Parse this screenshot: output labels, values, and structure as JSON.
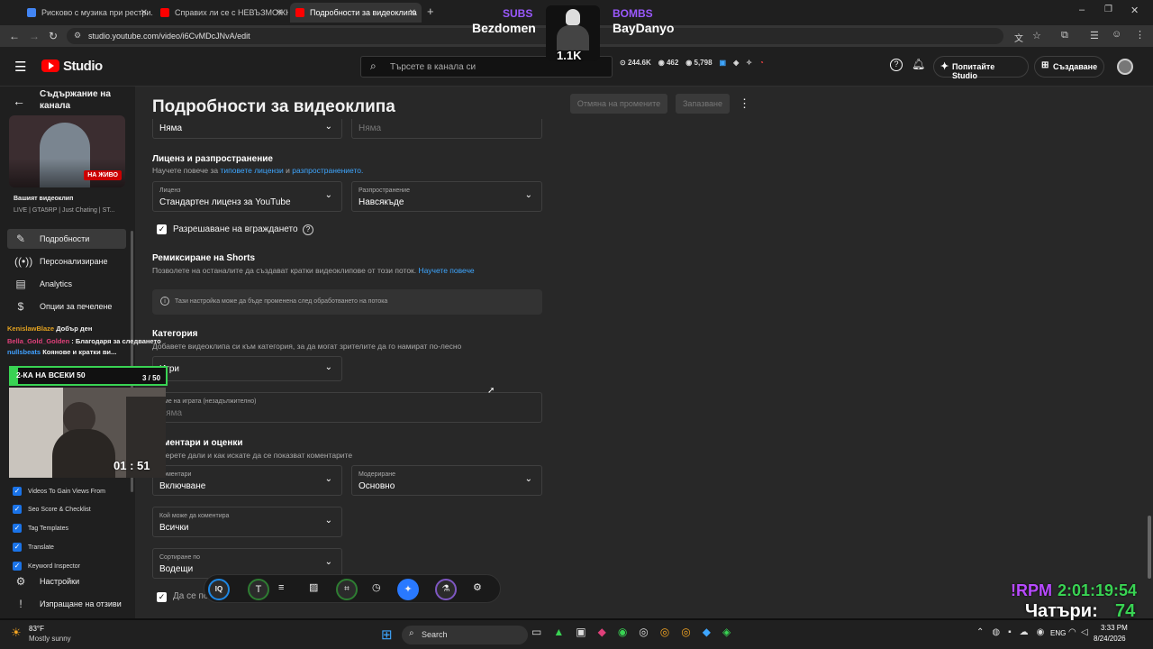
{
  "tabs": [
    {
      "title": "Рисково с музика при рестри...",
      "color": "#4285f4"
    },
    {
      "title": "Справих ли се с НЕВЪЗМОЖН...",
      "color": "#ff0000"
    },
    {
      "title": "Подробности за видеоклипа",
      "color": "#ff0000"
    }
  ],
  "url": "studio.youtube.com/video/i6CvMDcJNvA/edit",
  "studio": {
    "logo": "Studio",
    "search_placeholder": "Търсете в канала си",
    "stats": [
      "244.6K",
      "462",
      "5,798"
    ],
    "ask_label": "Попитайте Studio",
    "create_label": "Създаване"
  },
  "overlay": {
    "subs_label": "SUBS",
    "subs_name": "Bezdomen",
    "bombs_label": "BOMBS",
    "bombs_name": "BayDanyo",
    "count": "1.1K",
    "rpm_label": "!RPM",
    "rpm_time": "2:01:19:54",
    "chats_label": "Чатъри:",
    "chats_count": "74",
    "timer": "01 : 51",
    "goal_label": "2-КА НА ВСЕКИ 50",
    "goal_count": "3 / 50"
  },
  "chat": [
    {
      "user": "KenislawBlaze",
      "text": "Добър ден"
    },
    {
      "user": "Bella_Gold_Golden",
      "text": ": Благодаря за следването"
    },
    {
      "user": "nullsbeats",
      "text": "Коянове и кратки ви..."
    }
  ],
  "sidebar": {
    "title": "Съдържание на канала",
    "thumb_badge": "НА ЖИВО",
    "video_label": "Вашият видеоклип",
    "video_sub": "LIVE | GTA5RP | Just Chating | ST...",
    "items": [
      {
        "label": "Подробности",
        "icon": "pencil-icon"
      },
      {
        "label": "Персонализиране",
        "icon": "broadcast-icon"
      },
      {
        "label": "Analytics",
        "icon": "chart-icon"
      },
      {
        "label": "Опции за печелене",
        "icon": "dollar-icon"
      }
    ],
    "extensions": [
      "Videos To Gain Views From",
      "Seo Score & Checklist",
      "Tag Templates",
      "Translate",
      "Keyword Inspector"
    ],
    "settings": "Настройки",
    "feedback": "Изпращане на отзиви"
  },
  "page": {
    "title": "Подробности за видеоклипа",
    "undo": "Отмяна на промените",
    "save": "Запазване",
    "top_select": "Няма",
    "top_field": "Няма",
    "license_h": "Лиценз и разпространение",
    "license_d1": "Научете повече за",
    "license_link1": "типовете лицензи",
    "license_d2": "и",
    "license_link2": "разпространението.",
    "license_label": "Лиценз",
    "license_value": "Стандартен лиценз за YouTube",
    "dist_label": "Разпространение",
    "dist_value": "Навсякъде",
    "embed": "Разрешаване на вграждането",
    "remix_h": "Ремиксиране на Shorts",
    "remix_d": "Позволете на останалите да създават кратки видеоклипове от този поток.",
    "remix_link": "Научете повече",
    "info": "Тази настройка може да бъде променена след обработването на потока",
    "cat_h": "Категория",
    "cat_d": "Добавете видеоклипа си към категория, за да могат зрителите да го намират по-лесно",
    "cat_value": "Игри",
    "game_label": "Име на играта (незадължително)",
    "game_placeholder": "Няма",
    "comments_h": "Коментари и оценки",
    "comments_d": "Изберете дали и как искате да се показват коментарите",
    "comments_label": "Коментари",
    "comments_value": "Включване",
    "mod_label": "Модериране",
    "mod_value": "Основно",
    "who_label": "Кой може да коментира",
    "who_value": "Всички",
    "sort_label": "Сортиране по",
    "sort_value": "Водещи",
    "show_likes": "Да се показва колко зрители са харесали видеоклипа"
  },
  "taskbar": {
    "temp": "83°F",
    "weather": "Mostly sunny",
    "search": "Search",
    "lang": "ENG",
    "time": "3:33 PM",
    "date": "8/24/2026"
  }
}
